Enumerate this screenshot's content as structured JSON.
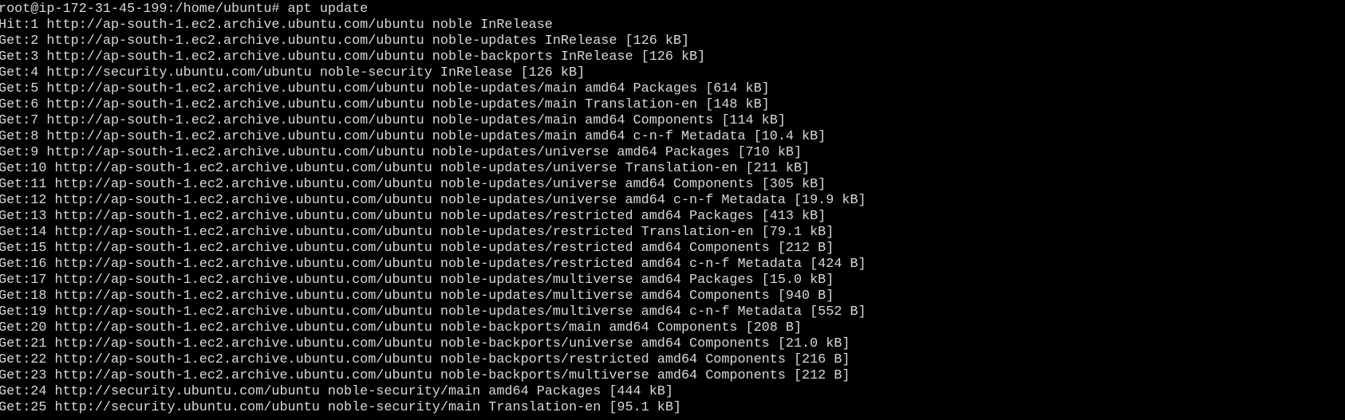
{
  "terminal": {
    "prompt": "root@ip-172-31-45-199:/home/ubuntu# apt update",
    "lines": [
      "Hit:1 http://ap-south-1.ec2.archive.ubuntu.com/ubuntu noble InRelease",
      "Get:2 http://ap-south-1.ec2.archive.ubuntu.com/ubuntu noble-updates InRelease [126 kB]",
      "Get:3 http://ap-south-1.ec2.archive.ubuntu.com/ubuntu noble-backports InRelease [126 kB]",
      "Get:4 http://security.ubuntu.com/ubuntu noble-security InRelease [126 kB]",
      "Get:5 http://ap-south-1.ec2.archive.ubuntu.com/ubuntu noble-updates/main amd64 Packages [614 kB]",
      "Get:6 http://ap-south-1.ec2.archive.ubuntu.com/ubuntu noble-updates/main Translation-en [148 kB]",
      "Get:7 http://ap-south-1.ec2.archive.ubuntu.com/ubuntu noble-updates/main amd64 Components [114 kB]",
      "Get:8 http://ap-south-1.ec2.archive.ubuntu.com/ubuntu noble-updates/main amd64 c-n-f Metadata [10.4 kB]",
      "Get:9 http://ap-south-1.ec2.archive.ubuntu.com/ubuntu noble-updates/universe amd64 Packages [710 kB]",
      "Get:10 http://ap-south-1.ec2.archive.ubuntu.com/ubuntu noble-updates/universe Translation-en [211 kB]",
      "Get:11 http://ap-south-1.ec2.archive.ubuntu.com/ubuntu noble-updates/universe amd64 Components [305 kB]",
      "Get:12 http://ap-south-1.ec2.archive.ubuntu.com/ubuntu noble-updates/universe amd64 c-n-f Metadata [19.9 kB]",
      "Get:13 http://ap-south-1.ec2.archive.ubuntu.com/ubuntu noble-updates/restricted amd64 Packages [413 kB]",
      "Get:14 http://ap-south-1.ec2.archive.ubuntu.com/ubuntu noble-updates/restricted Translation-en [79.1 kB]",
      "Get:15 http://ap-south-1.ec2.archive.ubuntu.com/ubuntu noble-updates/restricted amd64 Components [212 B]",
      "Get:16 http://ap-south-1.ec2.archive.ubuntu.com/ubuntu noble-updates/restricted amd64 c-n-f Metadata [424 B]",
      "Get:17 http://ap-south-1.ec2.archive.ubuntu.com/ubuntu noble-updates/multiverse amd64 Packages [15.0 kB]",
      "Get:18 http://ap-south-1.ec2.archive.ubuntu.com/ubuntu noble-updates/multiverse amd64 Components [940 B]",
      "Get:19 http://ap-south-1.ec2.archive.ubuntu.com/ubuntu noble-updates/multiverse amd64 c-n-f Metadata [552 B]",
      "Get:20 http://ap-south-1.ec2.archive.ubuntu.com/ubuntu noble-backports/main amd64 Components [208 B]",
      "Get:21 http://ap-south-1.ec2.archive.ubuntu.com/ubuntu noble-backports/universe amd64 Components [21.0 kB]",
      "Get:22 http://ap-south-1.ec2.archive.ubuntu.com/ubuntu noble-backports/restricted amd64 Components [216 B]",
      "Get:23 http://ap-south-1.ec2.archive.ubuntu.com/ubuntu noble-backports/multiverse amd64 Components [212 B]",
      "Get:24 http://security.ubuntu.com/ubuntu noble-security/main amd64 Packages [444 kB]",
      "Get:25 http://security.ubuntu.com/ubuntu noble-security/main Translation-en [95.1 kB]"
    ],
    "colors": {
      "background": "#000000",
      "foreground": "#d8d8d8"
    }
  }
}
